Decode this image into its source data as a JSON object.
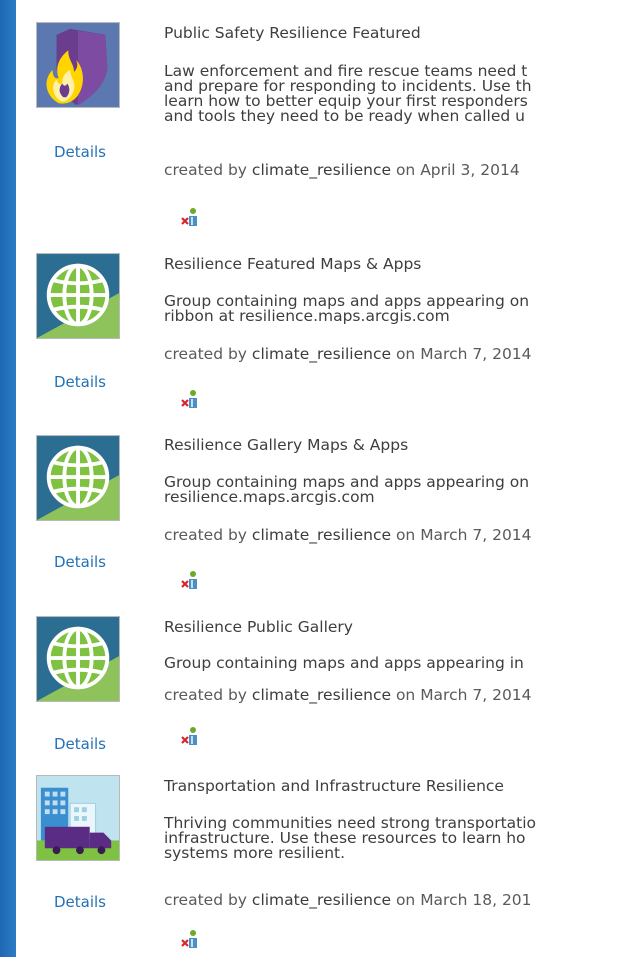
{
  "groups": [
    {
      "title": "Public Safety Resilience Featured",
      "description": [
        "Law enforcement and fire rescue teams need t",
        "and prepare for responding to incidents. Use th",
        "learn how to better equip your first responders",
        "and tools they need to be ready when called u"
      ],
      "created_by_label": "created by",
      "owner": "climate_resilience",
      "on_label": "on",
      "date": "April 3, 2014",
      "details_label": "Details",
      "thumbnail": "shield-flame-icon"
    },
    {
      "title": "Resilience Featured Maps & Apps",
      "description": [
        "Group containing maps and apps appearing on",
        "ribbon at resilience.maps.arcgis.com"
      ],
      "created_by_label": "created by",
      "owner": "climate_resilience",
      "on_label": "on",
      "date": "March 7, 2014",
      "details_label": "Details",
      "thumbnail": "globe-icon"
    },
    {
      "title": "Resilience Gallery Maps & Apps",
      "description": [
        "Group containing maps and apps appearing on",
        "resilience.maps.arcgis.com"
      ],
      "created_by_label": "created by",
      "owner": "climate_resilience",
      "on_label": "on",
      "date": "March 7, 2014",
      "details_label": "Details",
      "thumbnail": "globe-icon"
    },
    {
      "title": "Resilience Public Gallery",
      "description": [
        "Group containing maps and apps appearing in"
      ],
      "created_by_label": "created by",
      "owner": "climate_resilience",
      "on_label": "on",
      "date": "March 7, 2014",
      "details_label": "Details",
      "thumbnail": "globe-icon"
    },
    {
      "title": "Transportation and Infrastructure Resilience",
      "description": [
        "Thriving communities need strong transportatio",
        "infrastructure. Use these resources to learn ho",
        "systems more resilient."
      ],
      "created_by_label": "created by",
      "owner": "climate_resilience",
      "on_label": "on",
      "date": "March 18, 201",
      "details_label": "Details",
      "thumbnail": "truck-building-icon"
    }
  ],
  "badge_icon": "leave-group-icon",
  "colors": {
    "link": "#2372b5",
    "globe_bg": "#2c6e92",
    "globe_green": "#7fc241",
    "shield_purple": "#6b3d8f",
    "truck_purple": "#5b2c83"
  }
}
